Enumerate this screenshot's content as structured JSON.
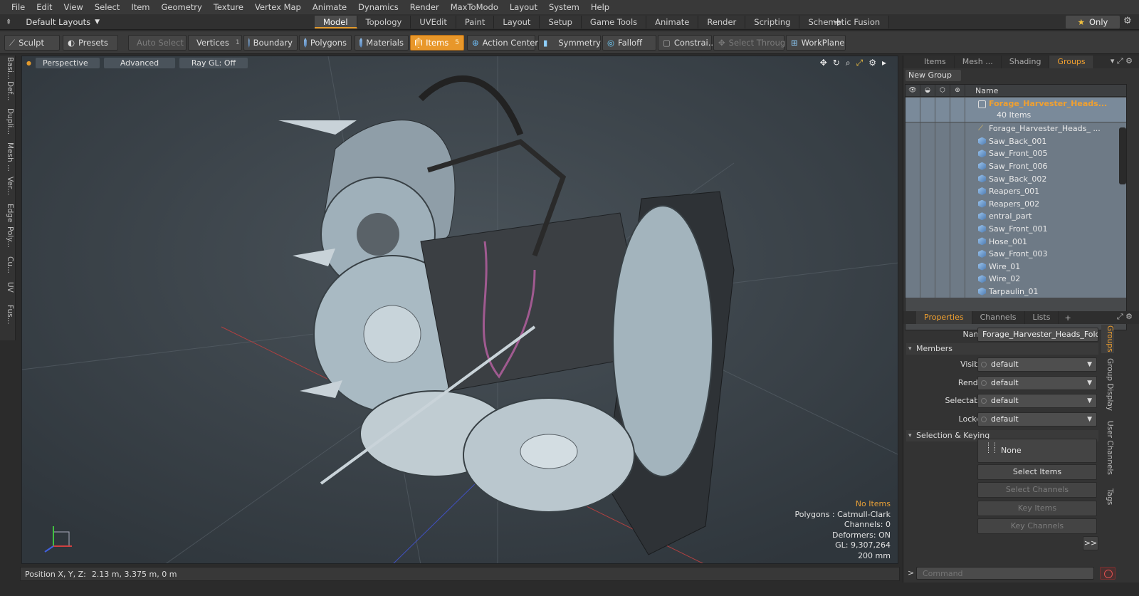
{
  "menu": [
    "File",
    "Edit",
    "View",
    "Select",
    "Item",
    "Geometry",
    "Texture",
    "Vertex Map",
    "Animate",
    "Dynamics",
    "Render",
    "MaxToModo",
    "Layout",
    "System",
    "Help"
  ],
  "layout_selector": "Default Layouts",
  "layout_tabs": [
    {
      "label": "Model",
      "active": true
    },
    {
      "label": "Topology"
    },
    {
      "label": "UVEdit"
    },
    {
      "label": "Paint"
    },
    {
      "label": "Layout"
    },
    {
      "label": "Setup"
    },
    {
      "label": "Game Tools"
    },
    {
      "label": "Animate"
    },
    {
      "label": "Render"
    },
    {
      "label": "Scripting"
    },
    {
      "label": "Schematic Fusion"
    }
  ],
  "only_label": "Only",
  "toolbar": {
    "sculpt": "Sculpt",
    "presets": "Presets",
    "auto_select": "Auto Select",
    "vertices": "Vertices",
    "vertices_badge": "1",
    "boundary": "Boundary",
    "polygons": "Polygons",
    "materials": "Materials",
    "items": "Items",
    "items_badge": "5",
    "action_center": "Action Center",
    "symmetry": "Symmetry",
    "falloff": "Falloff",
    "constraints": "Constrai...",
    "select_through": "Select Through",
    "workplane": "WorkPlane"
  },
  "left_tabs": [
    "Basi...",
    "Def...",
    "Dupli...",
    "Mesh ...",
    "Ver...",
    "Edge",
    "Poly...",
    "Cu...",
    "UV",
    "Fus..."
  ],
  "viewport": {
    "view": "Perspective",
    "advanced": "Advanced",
    "raygl": "Ray GL: Off",
    "info": {
      "selection": "No Items",
      "polygons": "Polygons : Catmull-Clark",
      "channels": "Channels: 0",
      "deformers": "Deformers: ON",
      "gl": "GL: 9,307,264",
      "scale": "200 mm"
    }
  },
  "status": {
    "label": "Position X, Y, Z:",
    "value": "2.13 m, 3.375 m, 0 m"
  },
  "right_tabs": [
    {
      "label": "Items"
    },
    {
      "label": "Mesh ..."
    },
    {
      "label": "Shading"
    },
    {
      "label": "Groups",
      "active": true
    }
  ],
  "groups": {
    "new_group": "New Group",
    "column_name": "Name",
    "group_name": "Forage_Harvester_Heads...",
    "group_count": "40 Items",
    "members": [
      "Forage_Harvester_Heads_ ...",
      "Saw_Back_001",
      "Saw_Front_005",
      "Saw_Front_006",
      "Saw_Back_002",
      "Reapers_001",
      "Reapers_002",
      "entral_part",
      "Saw_Front_001",
      "Hose_001",
      "Saw_Front_003",
      "Wire_01",
      "Wire_02",
      "Tarpaulin_01"
    ]
  },
  "prop_tabs": [
    {
      "label": "Properties",
      "active": true
    },
    {
      "label": "Channels"
    },
    {
      "label": "Lists"
    }
  ],
  "properties": {
    "name_label": "Name",
    "name_value": "Forage_Harvester_Heads_Folded",
    "members_section": "Members",
    "visible_label": "Visible",
    "visible_value": "default",
    "render_label": "Render",
    "render_value": "default",
    "selectable_label": "Selectable",
    "selectable_value": "default",
    "locked_label": "Locked",
    "locked_value": "default",
    "selkey_section": "Selection & Keying",
    "none_label": "None",
    "select_items": "Select Items",
    "select_channels": "Select Channels",
    "key_items": "Key Items",
    "key_channels": "Key Channels",
    "more": ">>"
  },
  "side_tabs": [
    {
      "label": "Groups",
      "active": true
    },
    {
      "label": "Group Display"
    },
    {
      "label": "User Channels"
    },
    {
      "label": "Tags"
    }
  ],
  "command_placeholder": "Command"
}
